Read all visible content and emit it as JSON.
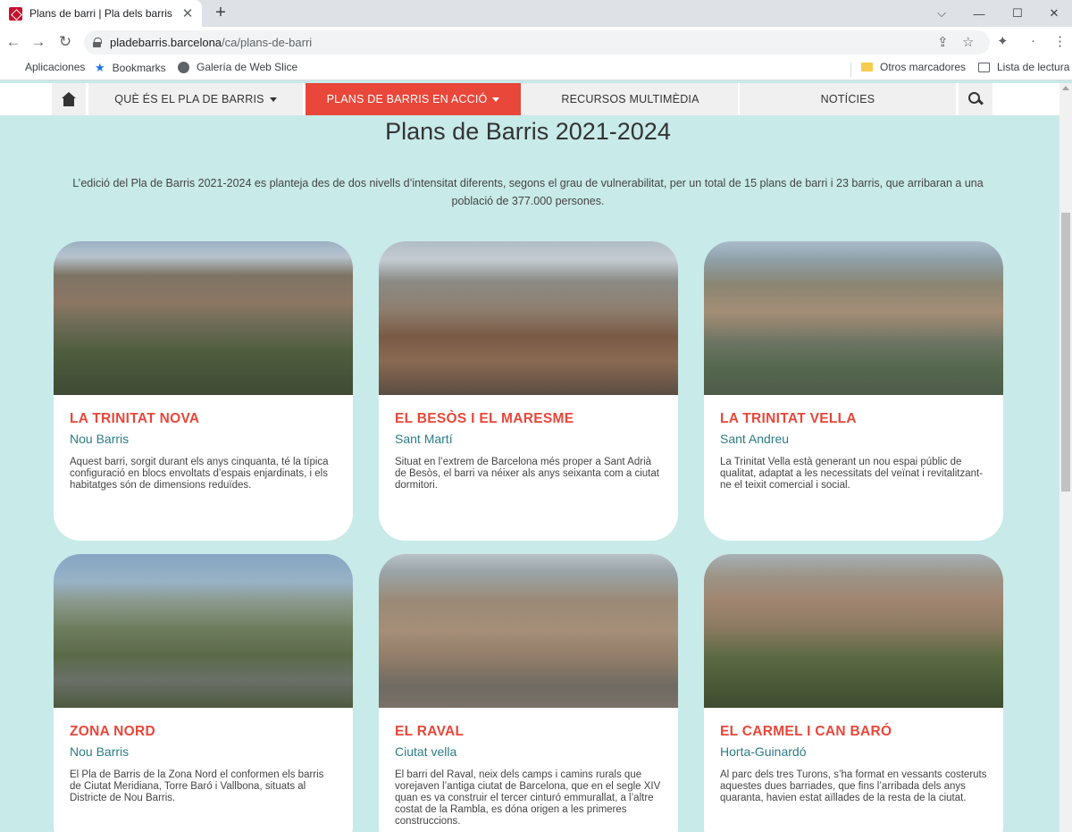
{
  "browser": {
    "tab_title": "Plans de barri | Pla dels barris de",
    "url_host": "pladebarris.barcelona",
    "url_path": "/ca/plans-de-barri"
  },
  "bookmarks": {
    "apps": "Aplicaciones",
    "bookmarks": "Bookmarks",
    "web_slice": "Galería de Web Slice",
    "other": "Otros marcadores",
    "reading_list": "Lista de lectura"
  },
  "site_nav": {
    "items": [
      {
        "label": "QUÈ ÉS EL PLA DE BARRIS"
      },
      {
        "label": "PLANS DE BARRIS EN ACCIÓ"
      },
      {
        "label": "RECURSOS MULTIMÈDIA"
      },
      {
        "label": "NOTÍCIES"
      }
    ],
    "active_color": "#e8473a"
  },
  "page": {
    "title": "Plans de Barris 2021-2024",
    "intro": "L’edició del Pla de Barris 2021-2024 es planteja des de dos nivells d’intensitat diferents, segons el grau de vulnerabilitat, per un total de 15 plans de barri i 23 barris, que arribaran a una població de 377.000 persones."
  },
  "cards": [
    {
      "title": "LA TRINITAT NOVA",
      "district": "Nou Barris",
      "desc": "Aquest barri, sorgit durant els anys cinquanta, té la típica configuració en blocs envoltats d’espais enjardinats, i els habitatges són de dimensions reduïdes."
    },
    {
      "title": "EL BESÒS I EL MARESME",
      "district": "Sant Martí",
      "desc": "Situat en l’extrem de Barcelona més proper a Sant Adrià de Besòs, el barri va néixer als anys seixanta com a ciutat dormitori."
    },
    {
      "title": "LA TRINITAT VELLA",
      "district": "Sant Andreu",
      "desc": "La Trinitat Vella està generant un nou espai públic de qualitat, adaptat a les necessitats del veïnat i revitalitzant-ne el teixit comercial i social."
    },
    {
      "title": "ZONA NORD",
      "district": "Nou Barris",
      "desc": "El Pla de Barris de la Zona Nord el conformen els barris de Ciutat Meridiana, Torre Baró i Vallbona, situats al Districte de Nou Barris."
    },
    {
      "title": "EL RAVAL",
      "district": "Ciutat vella",
      "desc": "El barri del Raval, neix dels camps i camins rurals que vorejaven l’antiga ciutat de Barcelona, que en el segle XIV quan es va construir el tercer cinturó emmurallat, a l’altre costat de la Rambla, es dóna origen a les primeres construccions."
    },
    {
      "title": "EL CARMEL I CAN BARÓ",
      "district": "Horta-Guinardó",
      "desc": "Al parc dels tres Turons, s’ha format en vessants costeruts aquestes dues barriades, que fins l’arribada dels anys quaranta, havien estat aïllades de la resta de la ciutat."
    }
  ],
  "colors": {
    "background": "#c8eae9",
    "accent": "#e8473a",
    "district": "#2c7d84"
  }
}
